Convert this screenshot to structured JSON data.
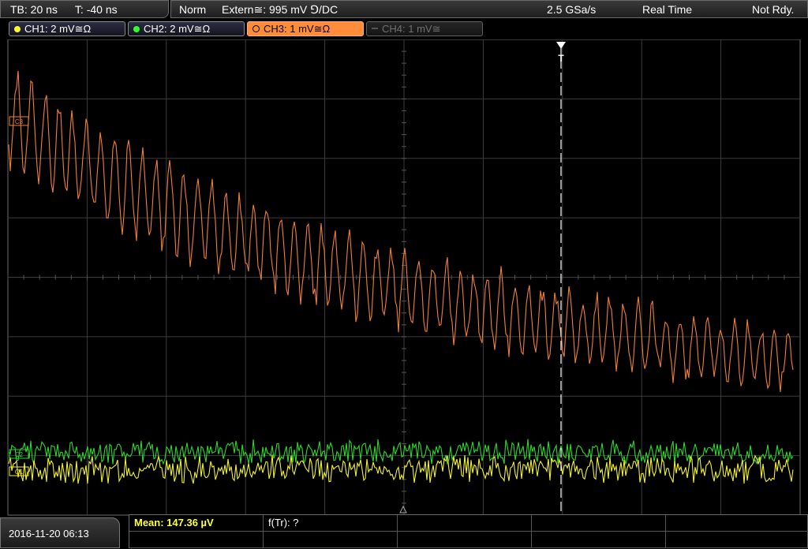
{
  "header": {
    "timebase": "TB: 20 ns",
    "trigger_offset": "T: -40 ns",
    "trigger_mode": "Norm",
    "trigger_source": "Extern≅: 995 mV ⅁/DC",
    "sample_rate": "2.5 GSa/s",
    "acq_mode": "Real Time",
    "status": "Not Rdy."
  },
  "channels": [
    {
      "label": "CH1: 2 mV≅Ω",
      "color": "#ffff30",
      "active": true
    },
    {
      "label": "CH2: 2 mV≅Ω",
      "color": "#30ff30",
      "active": true
    },
    {
      "label": "CH3: 1 mV≅Ω",
      "color": "#ff8c3a",
      "active": true,
      "selected": true
    },
    {
      "label": "CH4: 1 mV≅",
      "color": "#707070",
      "active": false
    }
  ],
  "markers": {
    "trigger": "T",
    "ch3_marker": "C3",
    "ch2_marker": "C2",
    "ch1_marker": "C1"
  },
  "footer": {
    "datetime": "2016-11-20 06:13",
    "mean": "Mean: 147.36 µV",
    "ftr": "f(Tr): ?"
  },
  "colors": {
    "ch1": "#f2f230",
    "ch2": "#2cd82c",
    "ch3": "#f07f35",
    "grid": "#3c3c3c",
    "trigger_line": "#ffffff"
  }
}
